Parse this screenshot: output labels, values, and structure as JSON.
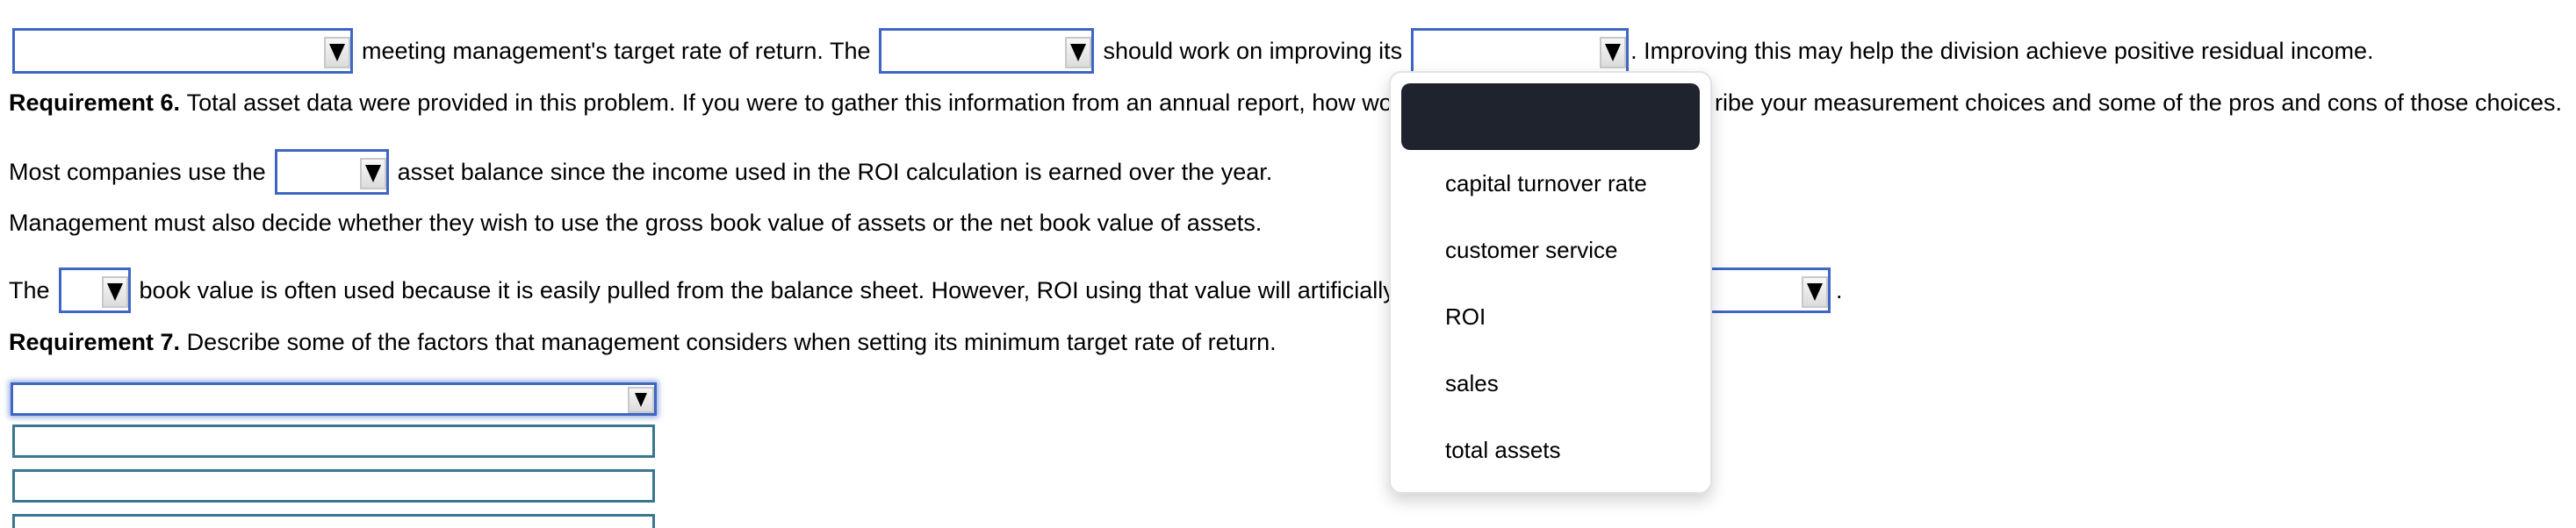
{
  "row1": {
    "text_a": "meeting management's target rate of return. The",
    "text_b": "should work on improving its",
    "text_c": ". Improving this may help the division achieve positive residual income.",
    "dropdown_1_value": "",
    "dropdown_2_value": "",
    "dropdown_3_value": ""
  },
  "req6": {
    "label": "Requirement 6.",
    "text_left": "Total asset data were provided in this problem. If you were to gather this information from an annual report, how would y",
    "text_right": "ribe your measurement choices and some of the pros and cons of those choices."
  },
  "most_companies": {
    "text_a": "Most companies use the",
    "text_b": "asset balance since the income used in the ROI calculation is earned over the year.",
    "dropdown_value": ""
  },
  "management": {
    "text": "Management must also decide whether they wish to use the gross book value of assets or the net book value of assets."
  },
  "book_value": {
    "text_a": "The",
    "text_b": "book value is often used because it is easily pulled from the balance sheet. However, ROI using that value will artificially rise",
    "text_c": ".",
    "dropdown_1_value": "",
    "dropdown_2_value": ""
  },
  "req7": {
    "label": "Requirement 7.",
    "text": "Describe some of the factors that management considers when setting its minimum target rate of return.",
    "dropdown_value": "",
    "inputs": [
      "",
      "",
      ""
    ]
  },
  "open_dropdown": {
    "options": [
      {
        "label": "",
        "selected": true
      },
      {
        "label": "capital turnover rate",
        "selected": false
      },
      {
        "label": "customer service",
        "selected": false
      },
      {
        "label": "ROI",
        "selected": false
      },
      {
        "label": "sales",
        "selected": false
      },
      {
        "label": "total assets",
        "selected": false
      }
    ]
  },
  "colors": {
    "select_border": "#3e66c4",
    "textbox_border": "#3a7690",
    "highlight": "#1f232d"
  }
}
